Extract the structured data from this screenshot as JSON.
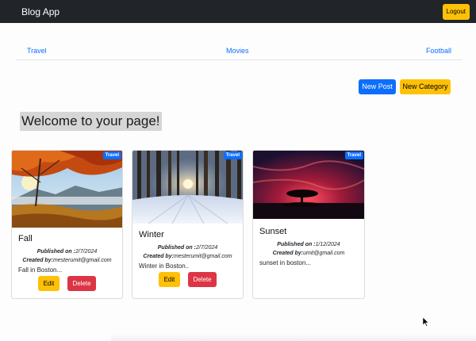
{
  "navbar": {
    "brand": "Blog App",
    "logout_label": "Logout"
  },
  "categories": [
    "Travel",
    "Movies",
    "Football"
  ],
  "actions": {
    "new_post_label": "New Post",
    "new_category_label": "New Category"
  },
  "welcome": "Welcome to your page!",
  "posts": [
    {
      "badge": "Travel",
      "title": "Fall",
      "published_label": "Published on :",
      "published": "2/7/2024",
      "created_label": "Created by:",
      "created_by": "mesterumit@gmail.com",
      "description": "Fall in Boston...",
      "edit_label": "Edit",
      "delete_label": "Delete"
    },
    {
      "badge": "Travel",
      "title": "Winter",
      "published_label": "Published on :",
      "published": "2/7/2024",
      "created_label": "Created by:",
      "created_by": "mesterumit@gmail.com",
      "description": "Winter in Boston..",
      "edit_label": "Edit",
      "delete_label": "Delete"
    },
    {
      "badge": "Travel",
      "title": "Sunset",
      "published_label": "Published on :",
      "published": "1/12/2024",
      "created_label": "Created by:",
      "created_by": "umit@gmail.com",
      "description": "sunset in boston...",
      "edit_label": "",
      "delete_label": ""
    }
  ],
  "colors": {
    "primary": "#0d6efd",
    "warning": "#ffc107",
    "danger": "#dc3545",
    "navbar": "#212529"
  }
}
